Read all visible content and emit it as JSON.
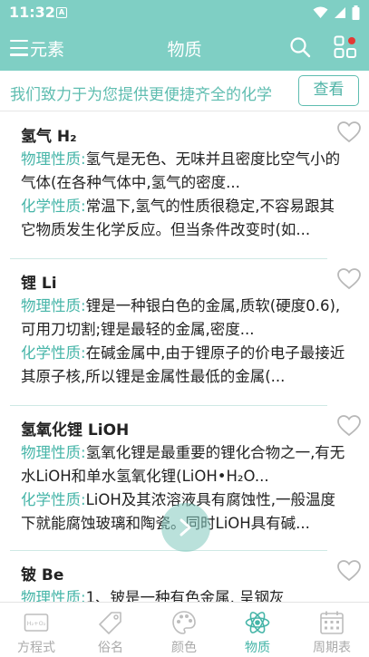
{
  "status_bar": {
    "time": "11:32",
    "notif_letter": "A"
  },
  "app_bar": {
    "left_label": "元素",
    "title": "物质"
  },
  "banner": {
    "text": "我们致力于为您提供更便捷齐全的化学",
    "button": "查看"
  },
  "items": [
    {
      "title": "氢气 H₂",
      "physical_label": "物理性质:",
      "physical_text": "氢气是无色、无味并且密度比空气小的气体(在各种气体中,氢气的密度...",
      "chemical_label": "化学性质:",
      "chemical_text": "常温下,氢气的性质很稳定,不容易跟其它物质发生化学反应。但当条件改变时(如..."
    },
    {
      "title": "锂 Li",
      "physical_label": "物理性质:",
      "physical_text": "锂是一种银白色的金属,质软(硬度0.6),可用刀切割;锂是最轻的金属,密度...",
      "chemical_label": "化学性质:",
      "chemical_text": "在碱金属中,由于锂原子的价电子最接近其原子核,所以锂是金属性最低的金属(..."
    },
    {
      "title": "氢氧化锂 LiOH",
      "physical_label": "物理性质:",
      "physical_text": "氢氧化锂是最重要的锂化合物之一,有无水LiOH和单水氢氧化锂(LiOH•H₂O...",
      "chemical_label": "化学性质:",
      "chemical_text": "LiOH及其浓溶液具有腐蚀性,一般温度下就能腐蚀玻璃和陶瓷。同时LiOH具有碱..."
    },
    {
      "title": "铍 Be",
      "physical_label": "物理性质:",
      "physical_text": "1、铍是一种有色金属, 呈钢灰",
      "chemical_label": "",
      "chemical_text": ""
    }
  ],
  "bottom_nav": [
    {
      "label": "方程式",
      "icon": "equation-icon",
      "active": false
    },
    {
      "label": "俗名",
      "icon": "tag-icon",
      "active": false
    },
    {
      "label": "颜色",
      "icon": "palette-icon",
      "active": false
    },
    {
      "label": "物质",
      "icon": "atom-icon",
      "active": true
    },
    {
      "label": "周期表",
      "icon": "calendar-grid-icon",
      "active": false
    }
  ],
  "colors": {
    "primary": "#7fcfc4",
    "accent_text": "#46b5a8",
    "badge_red": "#e53935"
  }
}
